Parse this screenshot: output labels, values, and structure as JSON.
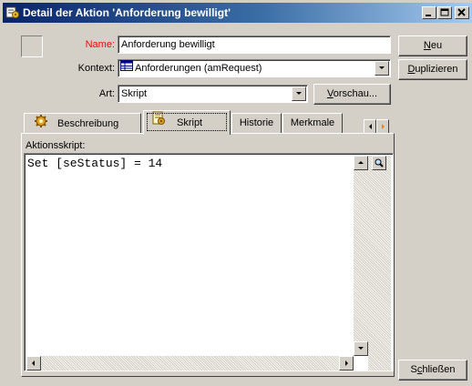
{
  "window": {
    "title": "Detail der Aktion 'Anforderung bewilligt'",
    "title_icon": "action-detail-icon",
    "controls": [
      "minimize-icon",
      "maximize-icon",
      "close-icon"
    ]
  },
  "form": {
    "name_label": "Name:",
    "name_value": "Anforderung bewilligt",
    "context_label": "Kontext:",
    "context_value": "Anforderungen (amRequest)",
    "art_label": "Art:",
    "art_value": "Skript",
    "preview_button": {
      "pre": "",
      "acc": "V",
      "post": "orschau..."
    }
  },
  "side_buttons": {
    "new": {
      "pre": "",
      "acc": "N",
      "post": "eu"
    },
    "duplicate": {
      "pre": "",
      "acc": "D",
      "post": "uplizieren"
    },
    "close": {
      "pre": "S",
      "acc": "c",
      "post": "hließen"
    }
  },
  "tabs": [
    {
      "label": "Beschreibung",
      "icon": "gear-icon",
      "active": false
    },
    {
      "label": "Skript",
      "icon": "script-icon",
      "active": true
    },
    {
      "label": "Historie",
      "active": false
    },
    {
      "label": "Merkmale",
      "active": false
    }
  ],
  "script_panel": {
    "label": "Aktionsskript:",
    "code": "Set [seStatus] = 14",
    "zoom_icon": "magnifier-icon"
  },
  "colors": {
    "face": "#d4d0c8",
    "title_start": "#0a246a",
    "title_end": "#a6caf0",
    "name_label": "#ff0000"
  }
}
